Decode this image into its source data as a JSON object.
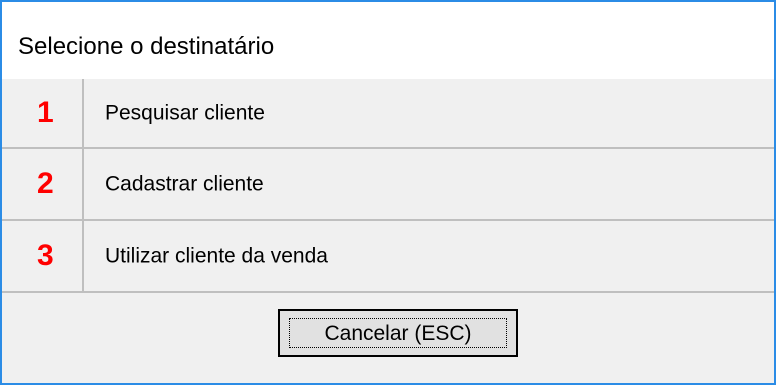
{
  "dialog": {
    "title": "Selecione o destinatário"
  },
  "options": [
    {
      "number": "1",
      "label": "Pesquisar cliente"
    },
    {
      "number": "2",
      "label": "Cadastrar cliente"
    },
    {
      "number": "3",
      "label": "Utilizar cliente da venda"
    }
  ],
  "cancel_button": {
    "label": "Cancelar (ESC)"
  },
  "colors": {
    "accent_border": "#2b8ce6",
    "number_red": "#ff0000",
    "panel_background": "#f0f0f0",
    "divider": "#bfbfbf"
  }
}
